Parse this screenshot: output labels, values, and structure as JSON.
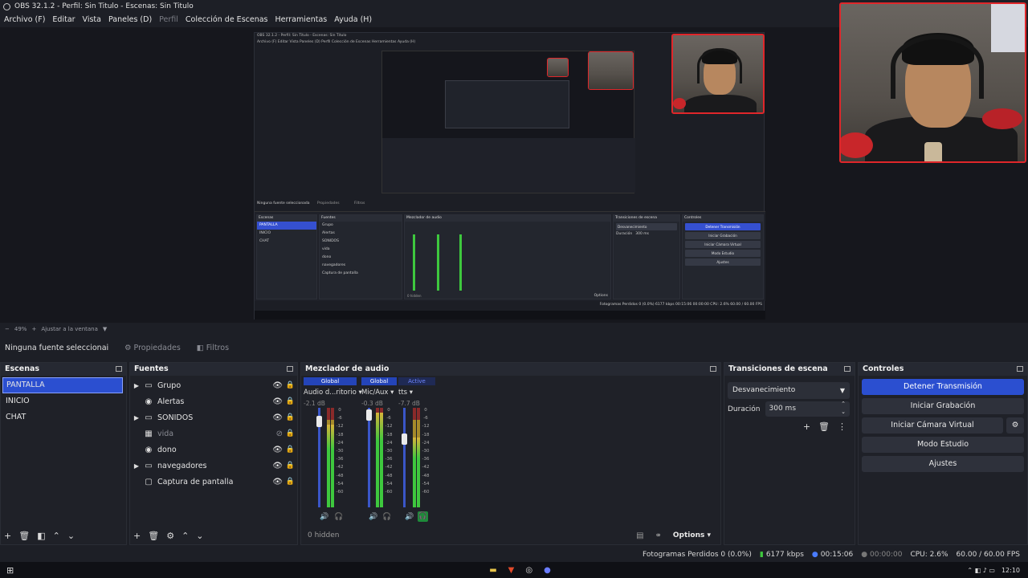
{
  "window": {
    "title": "OBS 32.1.2 - Perfil: Sin Titulo - Escenas: Sin Titulo"
  },
  "menu": [
    "Archivo (F)",
    "Editar",
    "Vista",
    "Paneles (D)",
    "Perfil",
    "Colección de Escenas",
    "Herramientas",
    "Ayuda (H)"
  ],
  "nested": {
    "title": "OBS 32.1.2 - Perfil: Sin Titulo - Escenas: Sin Titulo",
    "menu": "Archivo (F)   Editar   Vista   Paneles (D)   Perfil   Colección de Escenas   Herramientas   Ayuda (H)",
    "no_source": "Ninguna fuente seleccionada",
    "props": "Propiedades",
    "filters": "Filtros",
    "scenes_title": "Escenas",
    "sources_title": "Fuentes",
    "mixer_title": "Mezclador de audio",
    "transitions_title": "Transiciones de escena",
    "controls_title": "Controles",
    "scenes": [
      "PANTALLA",
      "INICIO",
      "CHAT"
    ],
    "sources": [
      "Grupo",
      "Alertas",
      "SONIDOS",
      "vida",
      "dono",
      "navegadores",
      "Captura de pantalla"
    ],
    "transition": "Desvanecimiento",
    "duration_label": "Duración",
    "duration": "300 ms",
    "controls": [
      "Detener Transmisión",
      "Iniciar Grabación",
      "Iniciar Cámara Virtual",
      "Modo Estudio",
      "Ajustes"
    ],
    "hidden": "0 hidden",
    "options": "Options",
    "status": "Fotogramas Perdidos 0 (0.0%)   6177 kbps   00:15:06   00:00:00   CPU: 2.6%   60.00 / 60.00 FPS"
  },
  "zoom": {
    "value": "49%",
    "fit": "Ajustar a la ventana"
  },
  "propbar": {
    "no_source": "Ninguna fuente seleccionai",
    "properties": "Propiedades",
    "filters": "Filtros"
  },
  "scenes": {
    "title": "Escenas",
    "items": [
      "PANTALLA",
      "INICIO",
      "CHAT"
    ]
  },
  "sources": {
    "title": "Fuentes",
    "items": [
      {
        "name": "Grupo",
        "icon": "folder-icon",
        "expand": true
      },
      {
        "name": "Alertas",
        "icon": "browser-icon",
        "expand": false
      },
      {
        "name": "SONIDOS",
        "icon": "folder-icon",
        "expand": true
      },
      {
        "name": "vida",
        "icon": "image-icon",
        "expand": false,
        "hidden": true
      },
      {
        "name": "dono",
        "icon": "browser-icon",
        "expand": false
      },
      {
        "name": "navegadores",
        "icon": "folder-icon",
        "expand": true
      },
      {
        "name": "Captura de pantalla",
        "icon": "monitor-icon",
        "expand": false
      }
    ]
  },
  "mixer": {
    "title": "Mezclador de audio",
    "channels": [
      {
        "tag": "Global",
        "name": "Audio d...ritorio",
        "db": "-2.1 dB",
        "level": 0.83
      },
      {
        "tag": "Global",
        "name": "Mic/Aux",
        "db": "-0.3 dB",
        "level": 0.95
      },
      {
        "tag": "Active",
        "name": "tts",
        "db": "-7.7 dB",
        "level": 0.7
      }
    ],
    "scale": [
      "0",
      "-6",
      "-12",
      "-18",
      "-24",
      "-30",
      "-36",
      "-42",
      "-48",
      "-54",
      "-60"
    ],
    "hidden": "0 hidden",
    "options": "Options"
  },
  "transitions": {
    "title": "Transiciones de escena",
    "type": "Desvanecimiento",
    "duration_label": "Duración",
    "duration": "300 ms"
  },
  "controls": {
    "title": "Controles",
    "buttons": [
      "Detener Transmisión",
      "Iniciar Grabación",
      "Iniciar Cámara Virtual",
      "Modo Estudio",
      "Ajustes"
    ]
  },
  "status": {
    "dropped": "Fotogramas Perdidos 0 (0.0%)",
    "bitrate": "6177 kbps",
    "stream_time": "00:15:06",
    "rec_time": "00:00:00",
    "cpu": "CPU: 2.6%",
    "fps": "60.00 / 60.00 FPS"
  },
  "taskbar": {
    "clock": "12:10"
  },
  "colors": {
    "accent": "#2b4fd0",
    "cam_border": "#e0262a",
    "bg": "#1d1f26"
  }
}
